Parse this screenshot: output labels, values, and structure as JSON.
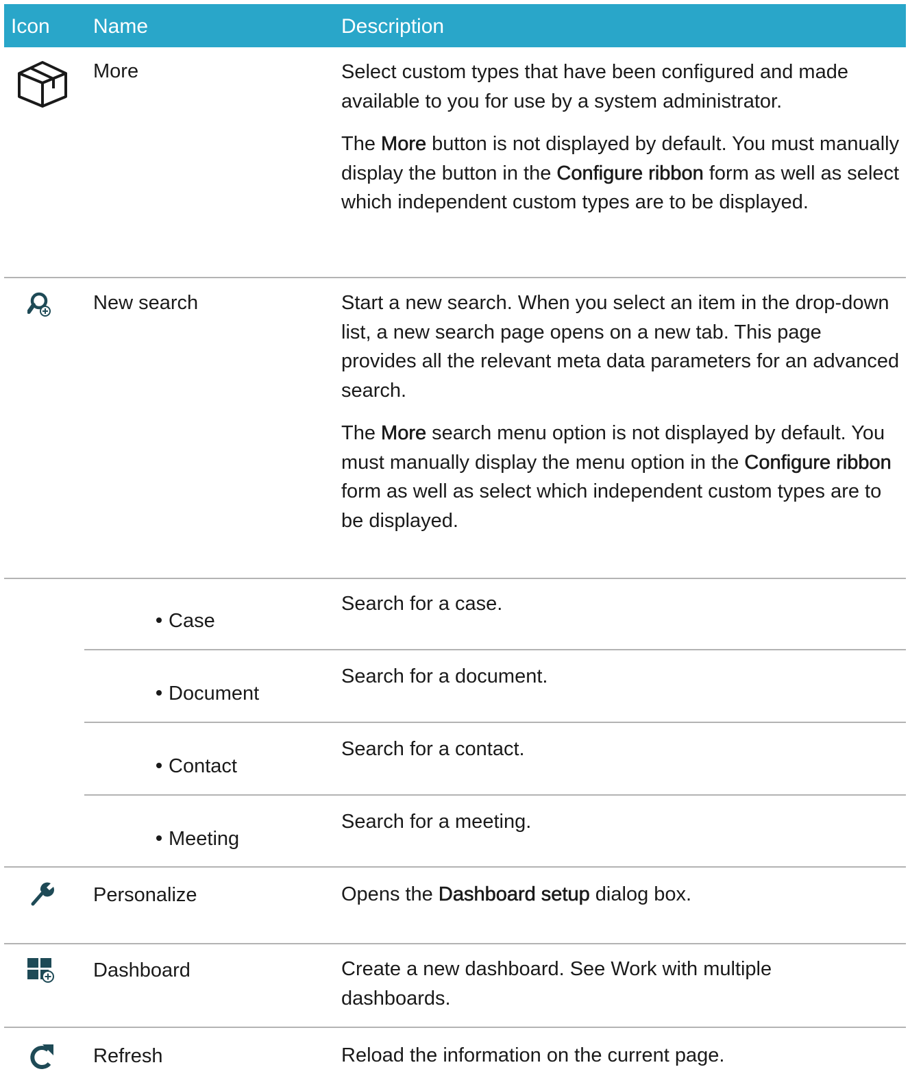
{
  "header": {
    "icon": "Icon",
    "name": "Name",
    "description": "Description"
  },
  "colors": {
    "header_bg": "#29a6c9",
    "icon_color": "#1e4a56"
  },
  "rows": {
    "more": {
      "icon": "box-icon",
      "name": "More",
      "p1": "Select custom types that have been configured and made available to you for use by a system administrator.",
      "p2_a": "The ",
      "p2_b": "More",
      "p2_c": " button is not displayed by default. You must manually display the button in the ",
      "p2_d": "Configure ribbon",
      "p2_e": " form as well as select which independent custom types are to be displayed."
    },
    "new_search": {
      "icon": "search-plus-icon",
      "name": "New search",
      "p1": "Start a new search. When you select an item in the drop-down list, a new search page opens on a new tab. This page provides all the relevant meta data parameters for an advanced search.",
      "p2_a": "The ",
      "p2_b": "More",
      "p2_c": " search menu option is not displayed by default. You must manually display the menu option in the ",
      "p2_d": "Configure ribbon",
      "p2_e": " form as well as select which independent custom types are to be displayed."
    },
    "case": {
      "name": "Case",
      "desc": "Search for a case."
    },
    "document": {
      "name": "Document",
      "desc": "Search for a document."
    },
    "contact": {
      "name": "Contact",
      "desc": "Search for a contact."
    },
    "meeting": {
      "name": "Meeting",
      "desc": "Search for a meeting."
    },
    "personalize": {
      "icon": "wrench-icon",
      "name": "Personalize",
      "d_a": "Opens the ",
      "d_b": "Dashboard setup",
      "d_c": " dialog box."
    },
    "dashboard": {
      "icon": "dashboard-plus-icon",
      "name": "Dashboard",
      "desc": "Create a new dashboard. See Work with multiple dashboards."
    },
    "refresh": {
      "icon": "refresh-icon",
      "name": "Refresh",
      "desc": "Reload the information on the current page."
    }
  }
}
